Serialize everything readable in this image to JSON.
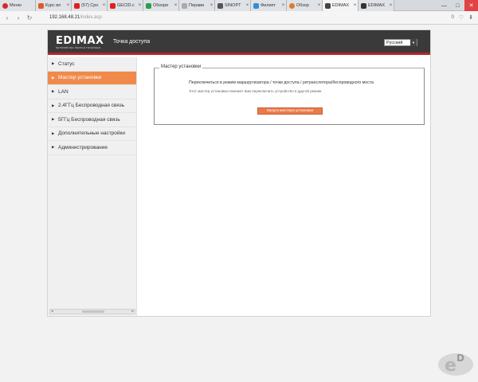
{
  "browser": {
    "tabs": [
      {
        "label": "Меню",
        "favicon_color": "#d62b2b",
        "active": false
      },
      {
        "label": "Курс вл",
        "favicon_color": "#e05a2a",
        "active": false
      },
      {
        "label": "(57) Сро",
        "favicon_color": "#e02020",
        "active": false
      },
      {
        "label": "GECID.c",
        "favicon_color": "#e02020",
        "active": false
      },
      {
        "label": "Обзори",
        "favicon_color": "#2f9e4c",
        "active": false
      },
      {
        "label": "Перави",
        "favicon_color": "#888888",
        "active": false
      },
      {
        "label": "SINOPT",
        "favicon_color": "#555555",
        "active": false
      },
      {
        "label": "Филипт",
        "favicon_color": "#3a8bd1",
        "active": false
      },
      {
        "label": "Обзор",
        "favicon_color": "#e07a2a",
        "active": false
      },
      {
        "label": "EDIMAX",
        "favicon_color": "#444444",
        "active": true
      },
      {
        "label": "EDIMAX",
        "favicon_color": "#333333",
        "active": false
      }
    ],
    "url_host": "192.168.48.21",
    "url_path": "/index.asp",
    "badge_count": "0"
  },
  "router": {
    "logo_text": "EDIMAX",
    "logo_tagline": "NETWORKING PEOPLE TOGETHER",
    "title": "Точка доступа",
    "language": "Русский",
    "menu": [
      {
        "label": "Статус",
        "active": false
      },
      {
        "label": "Мастер установки",
        "active": true
      },
      {
        "label": "LAN",
        "active": false
      },
      {
        "label": "2.4ГГц Беспроводная связь",
        "active": false
      },
      {
        "label": "5ГГц Беспроводная связь",
        "active": false
      },
      {
        "label": "Дополнительные настройки",
        "active": false
      },
      {
        "label": "Администрирование",
        "active": false
      }
    ],
    "wizard": {
      "legend": "Мастер установки",
      "line1": "Переключиться в режим маршрутизатора / точки доступа / ретранслятора/беспроводного моста",
      "line2": "Этот мастер установки поможет вам переключить устройство в другой режим.",
      "button": "Запуск мастера установки"
    }
  },
  "colors": {
    "accent_orange": "#f08a4b",
    "header_dark": "#3a3a3a",
    "header_red_line": "#b5252a"
  }
}
